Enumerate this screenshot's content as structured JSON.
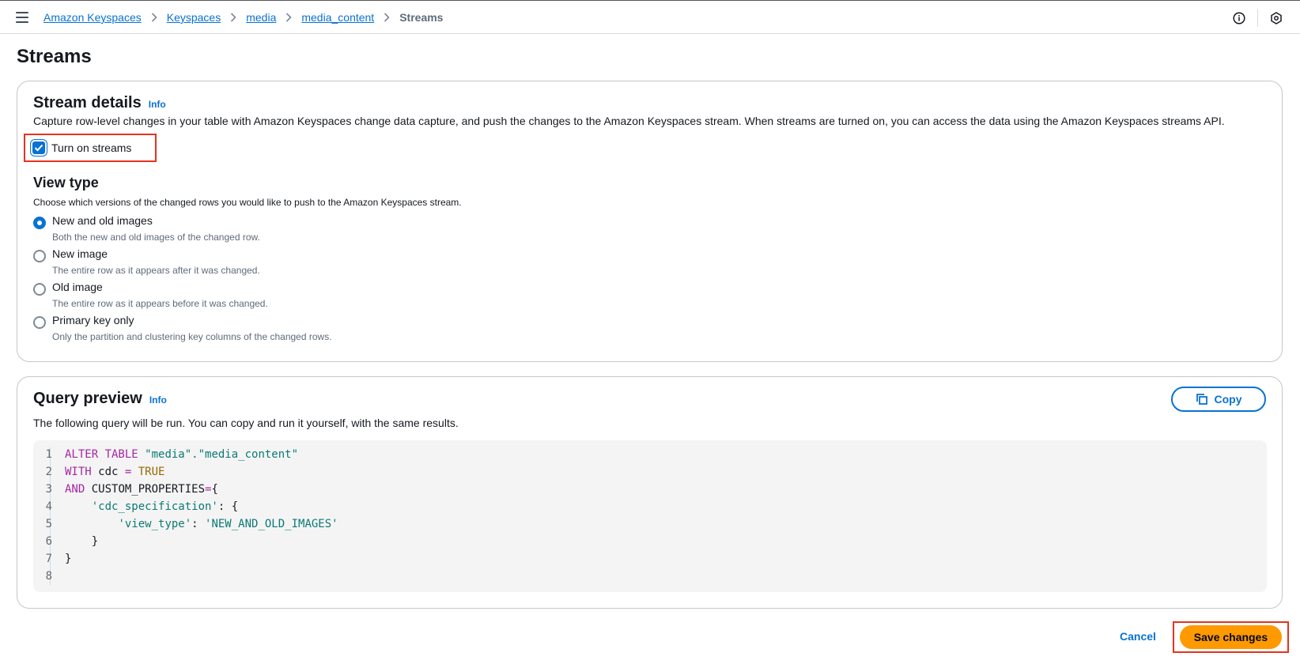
{
  "breadcrumb": {
    "items": [
      "Amazon Keyspaces",
      "Keyspaces",
      "media",
      "media_content"
    ],
    "current": "Streams"
  },
  "page": {
    "title": "Streams"
  },
  "stream_details": {
    "title": "Stream details",
    "info": "Info",
    "description": "Capture row-level changes in your table with Amazon Keyspaces change data capture, and push the changes to the Amazon Keyspaces stream. When streams are turned on, you can access the data using the Amazon Keyspaces streams API.",
    "checkbox_label": "Turn on streams",
    "checkbox_checked": true,
    "view_type": {
      "title": "View type",
      "description": "Choose which versions of the changed rows you would like to push to the Amazon Keyspaces stream.",
      "options": [
        {
          "label": "New and old images",
          "description": "Both the new and old images of the changed row.",
          "selected": true
        },
        {
          "label": "New image",
          "description": "The entire row as it appears after it was changed.",
          "selected": false
        },
        {
          "label": "Old image",
          "description": "The entire row as it appears before it was changed.",
          "selected": false
        },
        {
          "label": "Primary key only",
          "description": "Only the partition and clustering key columns of the changed rows.",
          "selected": false
        }
      ]
    }
  },
  "query_preview": {
    "title": "Query preview",
    "info": "Info",
    "description": "The following query will be run. You can copy and run it yourself, with the same results.",
    "copy_label": "Copy",
    "line_numbers": [
      "1",
      "2",
      "3",
      "4",
      "5",
      "6",
      "7",
      "8"
    ],
    "code": {
      "l1_kw": "ALTER TABLE",
      "l1_str": "\"media\".\"media_content\"",
      "l2_kw": "WITH",
      "l2_id": " cdc ",
      "l2_op": "=",
      "l2_val": "TRUE",
      "l3_kw": "AND",
      "l3_id": " CUSTOM_PROPERTIES",
      "l3_op": "=",
      "l3_brace": "{",
      "l4_str": "'cdc_specification'",
      "l4_rest": ": {",
      "l5_key": "'view_type'",
      "l5_colon": ": ",
      "l5_val": "'NEW_AND_OLD_IMAGES'",
      "l6": "}",
      "l7": "}"
    }
  },
  "footer": {
    "cancel_label": "Cancel",
    "save_label": "Save changes"
  },
  "colors": {
    "link": "#0972d3",
    "primary_button": "#ff9900",
    "highlight_border": "#e5331e"
  }
}
